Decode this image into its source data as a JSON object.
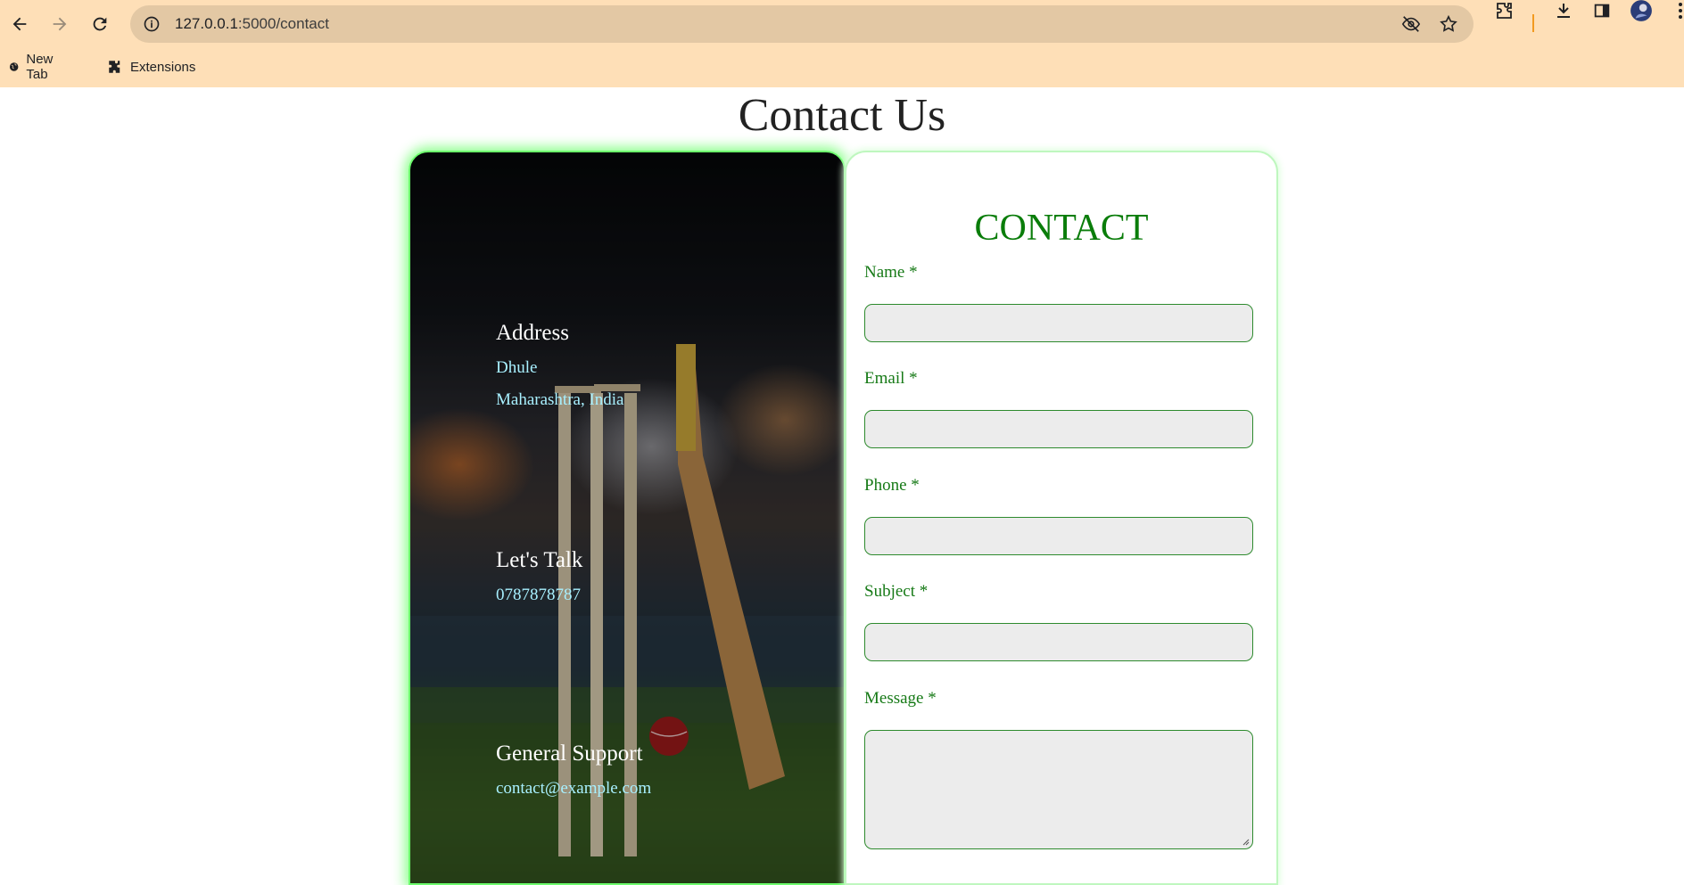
{
  "browser": {
    "url_host": "127.0.0.1",
    "url_path": ":5000/contact",
    "bookmarks": [
      {
        "label": "New Tab",
        "icon": "globe-icon"
      },
      {
        "label": "Extensions",
        "icon": "puzzle-icon"
      }
    ]
  },
  "page": {
    "title": "Contact Us"
  },
  "info": {
    "address_heading": "Address",
    "address_line1": "Dhule",
    "address_line2": "Maharashtra, India",
    "talk_heading": "Let's Talk",
    "phone": "0787878787",
    "support_heading": "General Support",
    "email": "contact@example.com"
  },
  "form": {
    "title": "CONTACT",
    "name_label": "Name *",
    "email_label": "Email *",
    "phone_label": "Phone *",
    "subject_label": "Subject *",
    "message_label": "Message *"
  },
  "colors": {
    "chrome_bg": "#fedfb7",
    "accent_green": "#0a7d0a",
    "info_text": "#a8f0ff"
  }
}
